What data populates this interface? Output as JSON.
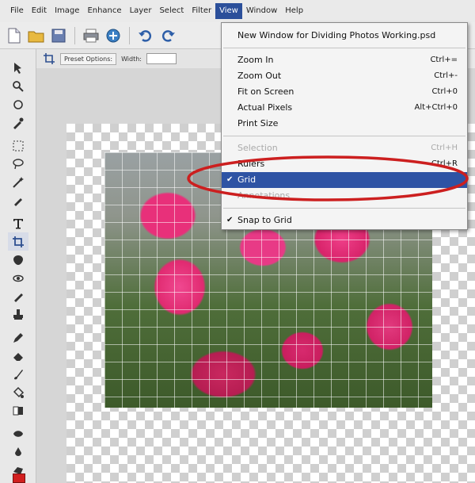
{
  "menubar": {
    "items": [
      "File",
      "Edit",
      "Image",
      "Enhance",
      "Layer",
      "Select",
      "Filter",
      "View",
      "Window",
      "Help"
    ],
    "active_index": 7
  },
  "options_bar": {
    "preset_label": "Preset Options:",
    "width_label": "Width:"
  },
  "view_menu": {
    "items": [
      {
        "label": "New Window for Dividing Photos Working.psd",
        "shortcut": "",
        "disabled": false,
        "checked": false,
        "highlight": false
      },
      {
        "separator": true
      },
      {
        "label": "Zoom In",
        "shortcut": "Ctrl+=",
        "disabled": false,
        "checked": false,
        "highlight": false
      },
      {
        "label": "Zoom Out",
        "shortcut": "Ctrl+-",
        "disabled": false,
        "checked": false,
        "highlight": false
      },
      {
        "label": "Fit on Screen",
        "shortcut": "Ctrl+0",
        "disabled": false,
        "checked": false,
        "highlight": false
      },
      {
        "label": "Actual Pixels",
        "shortcut": "Alt+Ctrl+0",
        "disabled": false,
        "checked": false,
        "highlight": false
      },
      {
        "label": "Print Size",
        "shortcut": "",
        "disabled": false,
        "checked": false,
        "highlight": false
      },
      {
        "separator": true
      },
      {
        "label": "Selection",
        "shortcut": "Ctrl+H",
        "disabled": true,
        "checked": false,
        "highlight": false
      },
      {
        "label": "Rulers",
        "shortcut": "Ctrl+R",
        "disabled": false,
        "checked": false,
        "highlight": false
      },
      {
        "label": "Grid",
        "shortcut": "",
        "disabled": false,
        "checked": true,
        "highlight": true
      },
      {
        "label": "Annotations",
        "shortcut": "",
        "disabled": true,
        "checked": false,
        "highlight": false
      },
      {
        "separator": true
      },
      {
        "label": "Snap to Grid",
        "shortcut": "",
        "disabled": false,
        "checked": true,
        "highlight": false
      }
    ]
  },
  "foreground_color": "#d21f1f",
  "accent_color": "#2e53a4",
  "annotation_color": "#cc1f1f"
}
